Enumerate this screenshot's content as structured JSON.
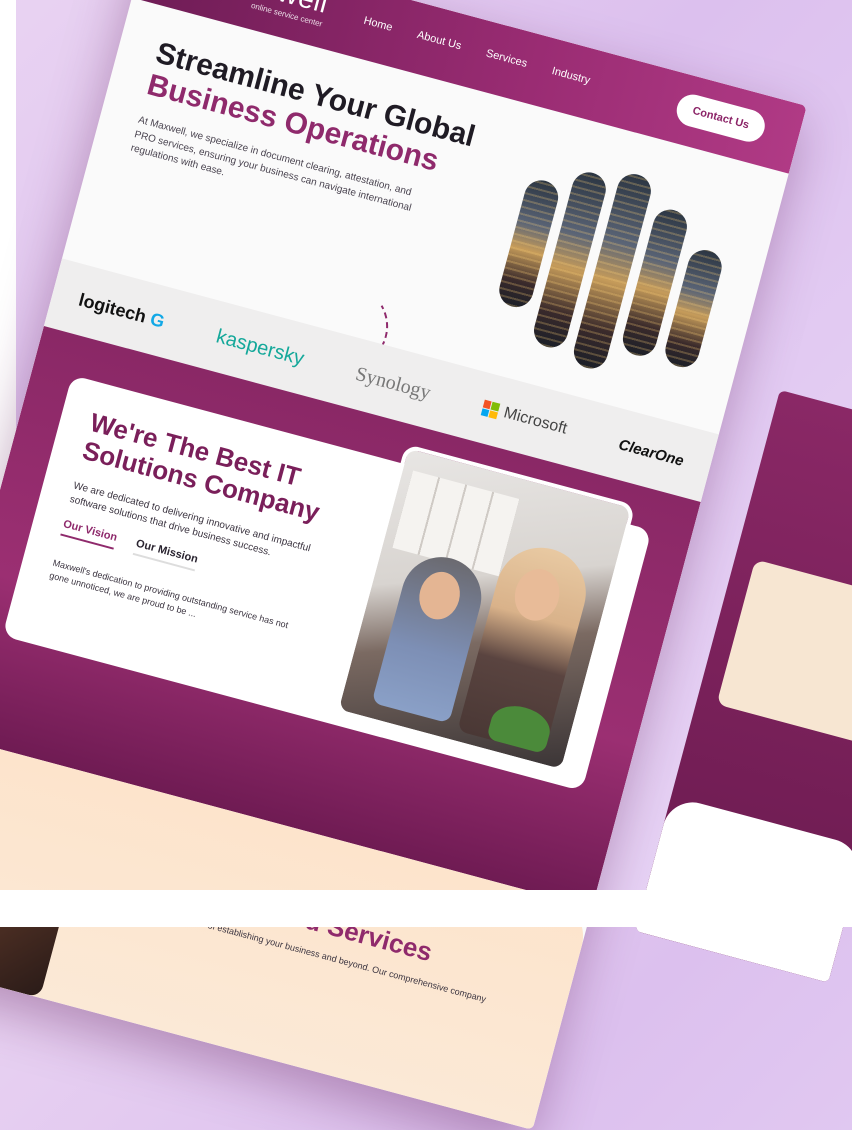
{
  "header": {
    "logo_text": "maxwell",
    "logo_sub": "online service center",
    "nav": [
      "Home",
      "About Us",
      "Services",
      "Industry"
    ],
    "contact_label": "Contact Us"
  },
  "hero": {
    "title_line1": "Streamline Your Global",
    "title_line2": "Business Operations",
    "description": "At Maxwell, we specialize in document clearing, attestation, and PRO services, ensuring your business can navigate international regulations with ease."
  },
  "partners": {
    "logitech": "logitech",
    "kaspersky": "kaspersky",
    "synology": "Synology",
    "microsoft": "Microsoft",
    "clearone": "ClearOne"
  },
  "about": {
    "title_line1": "We're The Best IT",
    "title_line2": "Solutions Company",
    "description": "We are dedicated to delivering innovative and impactful software solutions that drive business success.",
    "tabs": [
      "Our Vision",
      "Our Mission"
    ],
    "note": "Maxwell's dedication to providing outstanding service has not gone unnoticed, we are proud to be ..."
  },
  "offered": {
    "title": "Offered Services",
    "description": "Maxwell simplifies the process of establishing your business and beyond. Our comprehensive company for"
  },
  "colors": {
    "brand": "#8f2a6c",
    "brand_dark": "#6e1c55",
    "peach": "#fde4cc"
  }
}
